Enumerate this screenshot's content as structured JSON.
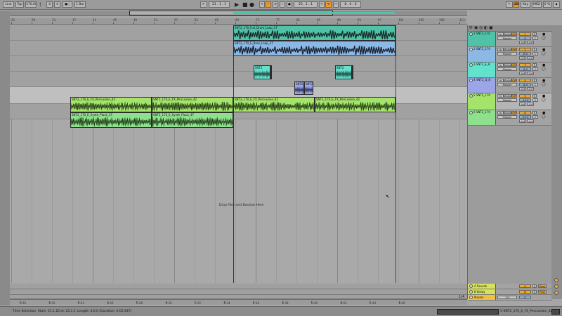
{
  "transport": {
    "link": "Link",
    "tap": "Tap",
    "tempo": "170.00",
    "time_sig_num": "4",
    "time_sig_den": "4",
    "metro": "1 Bar",
    "position": "21 .  1 .  1",
    "loop_start": "25 .  1 .  1",
    "loop_length": "8 .  0 .  0",
    "key": "Key",
    "midi": "MIDI",
    "cpu": "6 %"
  },
  "ruler_bars": [
    "25",
    "29",
    "33",
    "37",
    "41",
    "45",
    "49",
    "53",
    "57",
    "61",
    "65",
    "69",
    "73",
    "77",
    "81",
    "85",
    "89",
    "93",
    "97",
    "101",
    "105",
    "109",
    "113"
  ],
  "time_ticks": [
    "0:20",
    "0:22",
    "0:24",
    "0:26",
    "0:28",
    "0:30",
    "0:32",
    "0:34",
    "0:36",
    "0:38",
    "0:40",
    "0:42",
    "0:44",
    "0:46"
  ],
  "clips": [
    {
      "lane": 0,
      "name": "SNT2_170_Full_Drum_Loop_37",
      "color": "#4fc3a8"
    },
    {
      "lane": 1,
      "name": "SNT2_170_E_Bass_Loop_37",
      "color": "#8cb8e6"
    },
    {
      "lane": 2,
      "name": "SNT2",
      "color": "#62e2cc"
    },
    {
      "lane": 2,
      "name": "SNT2",
      "color": "#62e2cc"
    },
    {
      "lane": 2,
      "name": "SNT2",
      "color": "#62e2cc"
    },
    {
      "lane": 2,
      "name": "SNT2",
      "color": "#62e2cc"
    },
    {
      "lane": 3,
      "name": "SNT2",
      "color": "#9aa6e8"
    },
    {
      "lane": 3,
      "name": "SNT2_D",
      "color": "#9aa6e8"
    },
    {
      "lane": 4,
      "name": "SNT2_170_E_FX_Percussion_42",
      "color": "#a6e36a"
    },
    {
      "lane": 4,
      "name": "SNT2_170_E_FX_Percussion_42",
      "color": "#a6e36a"
    },
    {
      "lane": 4,
      "name": "SNT2_170_E_FX_Percussion_42",
      "color": "#a6e36a"
    },
    {
      "lane": 4,
      "name": "SNT2_170_E_FX_Percussion_42",
      "color": "#a6e36a"
    },
    {
      "lane": 5,
      "name": "SNT2_170_E_Synth_Pluck_47",
      "color": "#8ee08c"
    },
    {
      "lane": 5,
      "name": "SNT2_170_E_Synth_Pluck_47",
      "color": "#8ee08c"
    }
  ],
  "drop_text": "Drop Files and Devices Here",
  "tracks": [
    {
      "name": "1 SNT2_170",
      "color": "#4fc3a8",
      "in": "In",
      "auto": "Auto",
      "off": "Off",
      "out": "Master",
      "num": "1",
      "s": "S",
      "vol": "0",
      "pan": "C",
      "sends": [
        "-inf",
        "-inf"
      ]
    },
    {
      "name": "2 SNT2_170",
      "color": "#8cb8e6",
      "in": "In",
      "auto": "Auto",
      "off": "Off",
      "out": "Master",
      "num": "2",
      "s": "S",
      "vol": "-8.0",
      "pan": "C",
      "sends": [
        "-inf",
        "-inf"
      ]
    },
    {
      "name": "3 SNT2_E_B",
      "color": "#62e2cc",
      "in": "In",
      "auto": "Auto",
      "off": "Off",
      "out": "Master",
      "num": "3",
      "s": "S",
      "vol": "-8.0",
      "pan": "C",
      "sends": [
        "-inf",
        "-inf"
      ]
    },
    {
      "name": "4 SNT2_D_B",
      "color": "#9aa6e8",
      "in": "In",
      "auto": "Auto",
      "off": "Off",
      "out": "Master",
      "num": "4",
      "s": "S",
      "vol": "-8.0",
      "pan": "C",
      "sends": [
        "-inf",
        "-inf"
      ]
    },
    {
      "name": "5 SNT2_170",
      "color": "#a6e36a",
      "in": "In",
      "auto": "Auto",
      "off": "Off",
      "out": "Master",
      "num": "5",
      "s": "S",
      "vol": "-13.0",
      "pan": "C",
      "sends": [
        "-inf",
        "-inf"
      ]
    },
    {
      "name": "6 SNT2_170",
      "color": "#8ee08c",
      "in": "In",
      "auto": "Auto",
      "off": "Off",
      "out": "Master",
      "num": "6",
      "s": "S",
      "vol": "-15.0",
      "pan": "C",
      "sends": [
        "-inf",
        "-inf"
      ]
    }
  ],
  "returns": [
    {
      "name": "A Reverb",
      "color": "#d6e35a",
      "letter": "A",
      "s": "S",
      "post": "Post"
    },
    {
      "name": "B Delay",
      "color": "#d6e35a",
      "letter": "B",
      "s": "S",
      "post": "Post"
    },
    {
      "name": "Master",
      "color": "#f0c040",
      "out": "1/2",
      "vol": "0"
    }
  ],
  "quantize": "1/4",
  "status": {
    "sel_label": "Time Selection",
    "start": "Start: 21.1.1",
    "end": "End: 25.1.1",
    "length": "Length: 4.0.0 (Duration: 0:05.647)",
    "clip": "5-SNT2_170_E_FX_Percussion_42"
  },
  "colors": {
    "accent": "#f29b2d"
  }
}
